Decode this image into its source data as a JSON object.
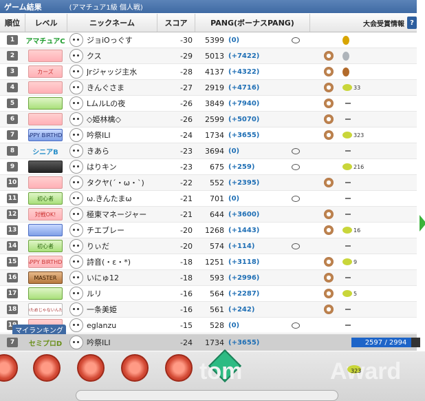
{
  "window": {
    "title": "ゲーム結果",
    "subtitle": "(アマチュア1級 個人戦)"
  },
  "header": {
    "rank": "順位",
    "level": "レベル",
    "nickname": "ニックネーム",
    "score": "スコア",
    "pang": "PANG(ボーナスPANG)",
    "award_info": "大会受賞情報"
  },
  "rows": [
    {
      "rank": "1",
      "level": "アマチュアC",
      "level_kind": "text",
      "name": "ジョiOっぐす",
      "score": "-30",
      "pang": "5399",
      "bonus": "(0)",
      "state": true,
      "icon": false,
      "award": "gold"
    },
    {
      "rank": "2",
      "level": "",
      "level_kind": "pink",
      "name": "クス",
      "score": "-29",
      "pang": "5013",
      "bonus": "(+7422)",
      "state": false,
      "icon": true,
      "award": "silver"
    },
    {
      "rank": "3",
      "level": "カーズ",
      "level_kind": "pink",
      "name": "Jrジャッジ主水",
      "score": "-28",
      "pang": "4137",
      "bonus": "(+4322)",
      "state": false,
      "icon": true,
      "award": "bronze"
    },
    {
      "rank": "4",
      "level": "",
      "level_kind": "pink",
      "name": "きんぐさま",
      "score": "-27",
      "pang": "2919",
      "bonus": "(+4716)",
      "state": false,
      "icon": true,
      "award": "33"
    },
    {
      "rank": "5",
      "level": "",
      "level_kind": "green",
      "name": "LムルLの夜",
      "score": "-26",
      "pang": "3849",
      "bonus": "(+7940)",
      "state": false,
      "icon": true,
      "award": "dash"
    },
    {
      "rank": "6",
      "level": "",
      "level_kind": "pink",
      "name": "◇姫林檎◇",
      "score": "-26",
      "pang": "2599",
      "bonus": "(+5070)",
      "state": false,
      "icon": true,
      "award": "dash"
    },
    {
      "rank": "7",
      "level": "HAPPY BIRTHDAY",
      "level_kind": "blue",
      "name": "吟祭ILI",
      "score": "-24",
      "pang": "1734",
      "bonus": "(+3655)",
      "state": false,
      "icon": true,
      "award": "323"
    },
    {
      "rank": "8",
      "level": "シニアB",
      "level_kind": "text-blue",
      "name": "きあら",
      "score": "-23",
      "pang": "3694",
      "bonus": "(0)",
      "state": true,
      "icon": false,
      "award": "dash"
    },
    {
      "rank": "9",
      "level": "",
      "level_kind": "dark",
      "name": "はりキン",
      "score": "-23",
      "pang": "675",
      "bonus": "(+259)",
      "state": true,
      "icon": false,
      "award": "216"
    },
    {
      "rank": "10",
      "level": "",
      "level_kind": "pink",
      "name": "タクヤ(´・ω・`)",
      "score": "-22",
      "pang": "552",
      "bonus": "(+2395)",
      "state": false,
      "icon": true,
      "award": "dash"
    },
    {
      "rank": "11",
      "level": "初心者",
      "level_kind": "green",
      "name": "ω.きんたまω",
      "score": "-21",
      "pang": "701",
      "bonus": "(0)",
      "state": true,
      "icon": false,
      "award": "dash"
    },
    {
      "rank": "12",
      "level": "対戦OK!",
      "level_kind": "pink",
      "name": "極東マネージャー",
      "score": "-21",
      "pang": "644",
      "bonus": "(+3600)",
      "state": false,
      "icon": true,
      "award": "dash"
    },
    {
      "rank": "13",
      "level": "",
      "level_kind": "blue",
      "name": "チエブレー",
      "score": "-20",
      "pang": "1268",
      "bonus": "(+1443)",
      "state": false,
      "icon": true,
      "award": "16"
    },
    {
      "rank": "14",
      "level": "初心者",
      "level_kind": "green",
      "name": "りぃだ",
      "score": "-20",
      "pang": "574",
      "bonus": "(+114)",
      "state": true,
      "icon": false,
      "award": "dash"
    },
    {
      "rank": "15",
      "level": "HAPPY BIRTHDAY",
      "level_kind": "pink",
      "name": "詩音(・ε・*)",
      "score": "-18",
      "pang": "1251",
      "bonus": "(+3118)",
      "state": false,
      "icon": true,
      "award": "9"
    },
    {
      "rank": "16",
      "level": "MASTER",
      "level_kind": "brown",
      "name": "いにゅ12",
      "score": "-18",
      "pang": "593",
      "bonus": "(+2996)",
      "state": false,
      "icon": true,
      "award": "dash"
    },
    {
      "rank": "17",
      "level": "",
      "level_kind": "green",
      "name": "ルリ",
      "score": "-16",
      "pang": "564",
      "bonus": "(+2287)",
      "state": false,
      "icon": true,
      "award": "5"
    },
    {
      "rank": "18",
      "level": "アンタのためじゃないんだからね!",
      "level_kind": "text-small",
      "name": "一条美姫",
      "score": "-16",
      "pang": "561",
      "bonus": "(+242)",
      "state": false,
      "icon": true,
      "award": "dash"
    },
    {
      "rank": "19",
      "level": "",
      "level_kind": "pink",
      "name": "eglanzu",
      "score": "-15",
      "pang": "528",
      "bonus": "(0)",
      "state": true,
      "icon": false,
      "award": "dash"
    }
  ],
  "my_ranking": {
    "tab": "マイランキング",
    "rank": "7",
    "level": "セミプロD",
    "name": "吟祭ILI",
    "score": "-24",
    "pang": "1734",
    "bonus": "(+3655)",
    "progress_text": "2597 / 2994",
    "progress_fraction": 0.867
  },
  "bottom": {
    "watermark_left": "tom",
    "watermark_right": "Award",
    "award_count": "323"
  },
  "colors": {
    "title_bar": "#3f6aa3",
    "bonus_text": "#1f6fb5",
    "progress": "#1d64c8"
  }
}
